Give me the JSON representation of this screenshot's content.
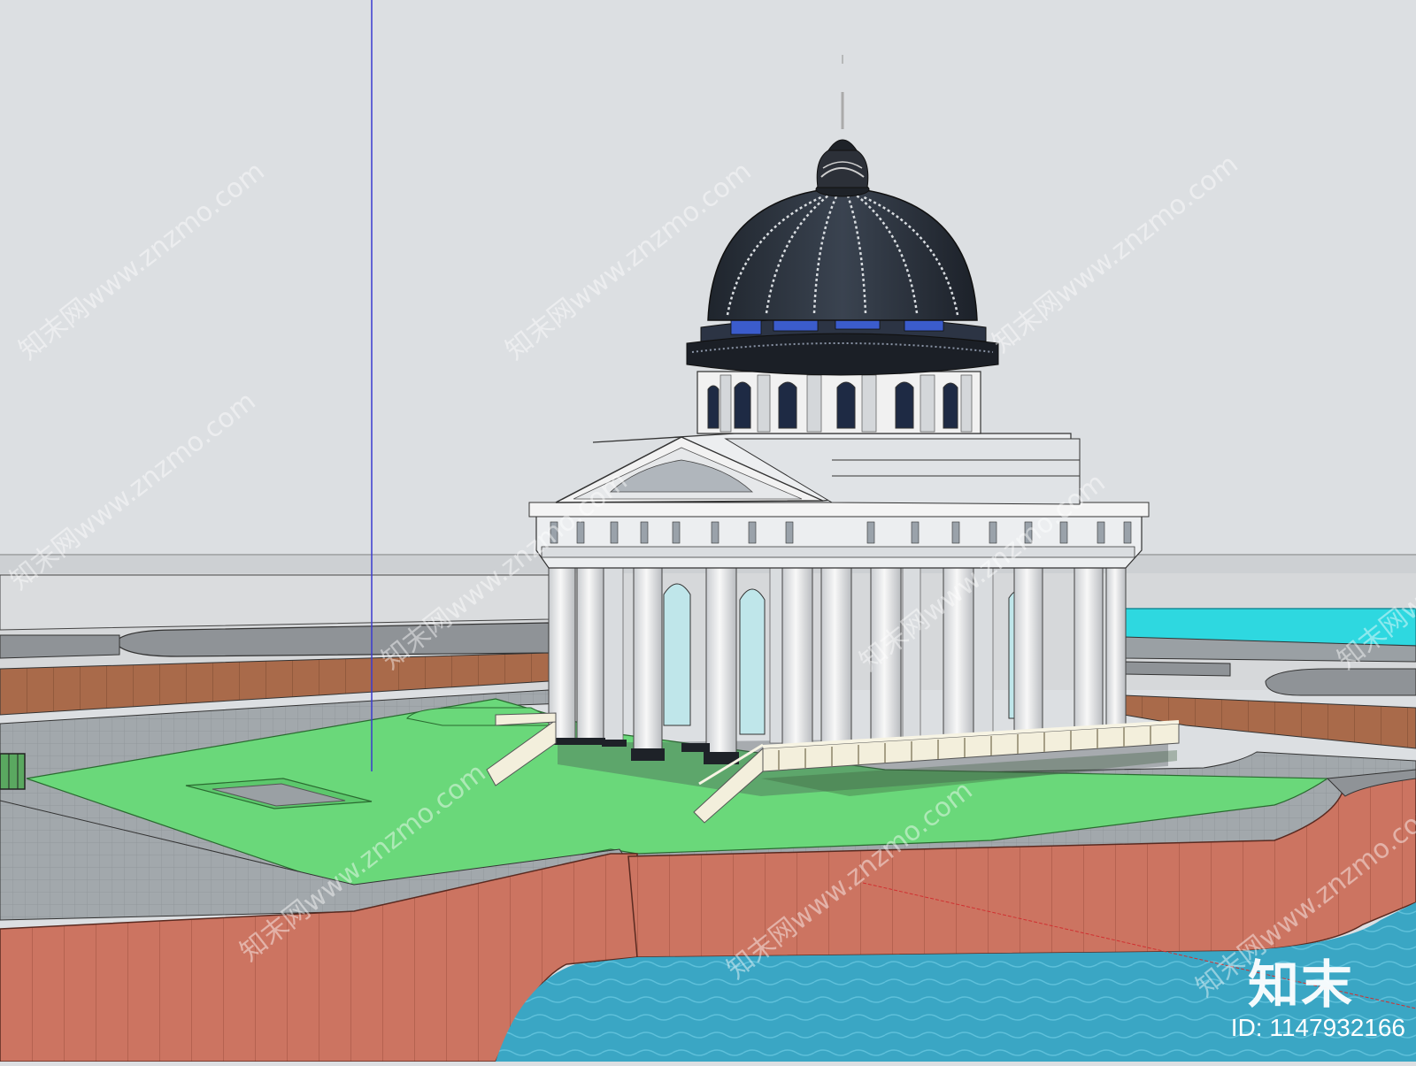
{
  "viewport": {
    "name": "3d-model-viewport",
    "description_colors": {
      "sky": "#dcdfe2",
      "ground_lawn": "#6ad87a",
      "paving": "#9aa0a4",
      "retaining_wall": "#c9705e",
      "water": "#2ea8c8",
      "pool": "#2ed8e0",
      "dome": "#2c333d",
      "building": "#f2f2f2",
      "axis_blue": "#3a3ad0",
      "axis_red": "#d03030"
    }
  },
  "watermark": {
    "text": "知末网www.znzmo.com"
  },
  "branding": {
    "logo": "知末",
    "id_label": "ID: 1147932166"
  }
}
